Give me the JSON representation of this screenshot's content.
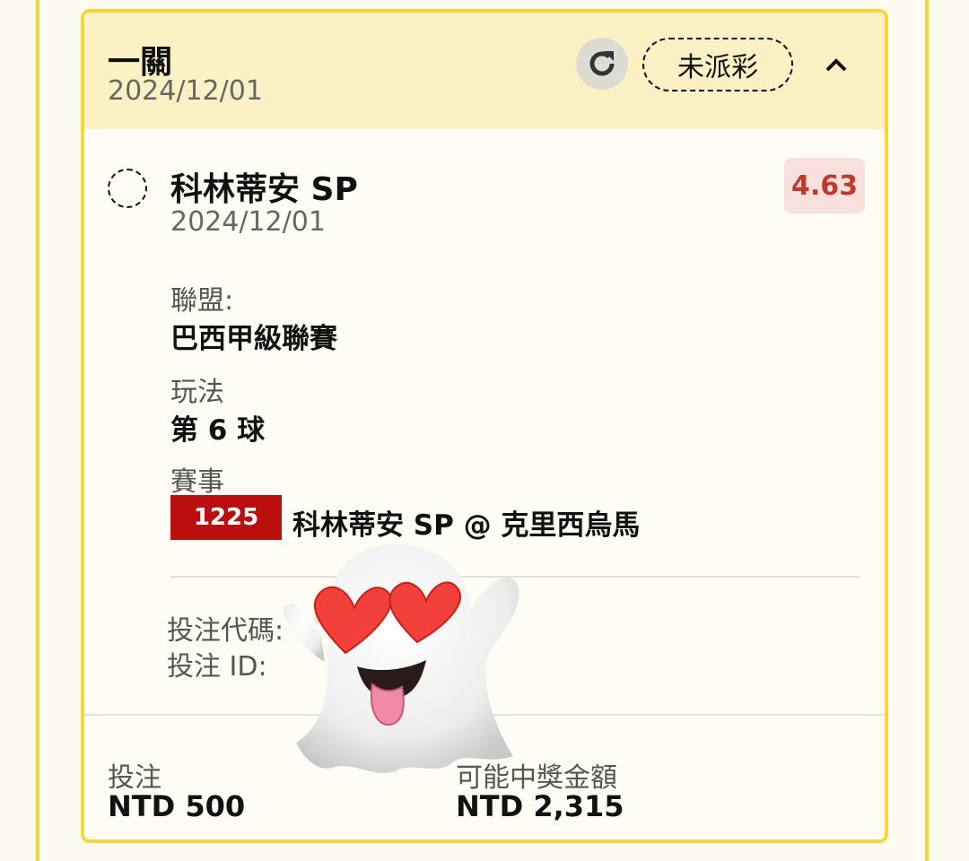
{
  "card": {
    "title": "一關",
    "date": "2024/12/01",
    "status_label": "未派彩"
  },
  "selection": {
    "name": "科林蒂安 SP",
    "date": "2024/12/01",
    "odds": "4.63"
  },
  "details": {
    "league_label": "聯盟:",
    "league_value": "巴西甲級聯賽",
    "play_label": "玩法",
    "play_value": "第 6 球",
    "event_label": "賽事",
    "event_id": "1225",
    "event_teams": "科林蒂安 SP @ 克里西烏馬"
  },
  "bet_info": {
    "code_label": "投注代碼:",
    "id_label": "投注 ID:"
  },
  "footer": {
    "stake_label": "投注",
    "stake_value": "NTD 500",
    "payout_label": "可能中獎金額",
    "payout_value": "NTD 2,315"
  },
  "icons": {
    "refresh": "refresh-icon",
    "collapse": "chevron-up-icon",
    "ghost": "ghost-heart-eyes-sticker"
  }
}
